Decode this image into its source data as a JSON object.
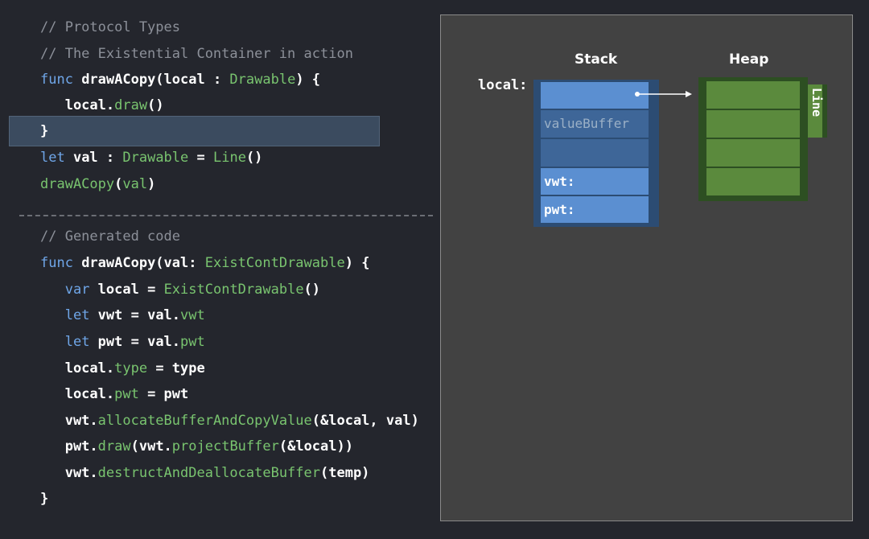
{
  "code": {
    "lines": [
      [
        {
          "t": "// Protocol Types",
          "c": "comment"
        }
      ],
      [
        {
          "t": "// The Existential Container in action",
          "c": "comment"
        }
      ],
      [
        {
          "t": "func",
          "c": "kw"
        },
        {
          "t": " drawACopy(local : ",
          "c": "w"
        },
        {
          "t": "Drawable",
          "c": "fn"
        },
        {
          "t": ") {",
          "c": "w"
        }
      ],
      [
        {
          "t": "   local.",
          "c": "w"
        },
        {
          "t": "draw",
          "c": "fn"
        },
        {
          "t": "()",
          "c": "w"
        }
      ],
      [
        {
          "t": "}",
          "c": "w"
        }
      ],
      [
        {
          "t": "let",
          "c": "kw"
        },
        {
          "t": " val : ",
          "c": "w"
        },
        {
          "t": "Drawable",
          "c": "fn"
        },
        {
          "t": " = ",
          "c": "w"
        },
        {
          "t": "Line",
          "c": "fn"
        },
        {
          "t": "()",
          "c": "w"
        }
      ],
      [
        {
          "t": "drawACopy",
          "c": "fn"
        },
        {
          "t": "(",
          "c": "w"
        },
        {
          "t": "val",
          "c": "fn"
        },
        {
          "t": ")",
          "c": "w"
        }
      ],
      [
        {
          "t": "// Generated code",
          "c": "comment"
        }
      ],
      [
        {
          "t": "func",
          "c": "kw"
        },
        {
          "t": " drawACopy(val: ",
          "c": "w"
        },
        {
          "t": "ExistContDrawable",
          "c": "fn"
        },
        {
          "t": ") {",
          "c": "w"
        }
      ],
      [
        {
          "t": "   ",
          "c": "w"
        },
        {
          "t": "var",
          "c": "kw"
        },
        {
          "t": " local = ",
          "c": "w"
        },
        {
          "t": "ExistContDrawable",
          "c": "fn"
        },
        {
          "t": "()",
          "c": "w"
        }
      ],
      [
        {
          "t": "   ",
          "c": "w"
        },
        {
          "t": "let",
          "c": "kw"
        },
        {
          "t": " vwt = val.",
          "c": "w"
        },
        {
          "t": "vwt",
          "c": "fn"
        }
      ],
      [
        {
          "t": "   ",
          "c": "w"
        },
        {
          "t": "let",
          "c": "kw"
        },
        {
          "t": " pwt = val.",
          "c": "w"
        },
        {
          "t": "pwt",
          "c": "fn"
        }
      ],
      [
        {
          "t": "   local.",
          "c": "w"
        },
        {
          "t": "type",
          "c": "fn"
        },
        {
          "t": " = type",
          "c": "w"
        }
      ],
      [
        {
          "t": "   local.",
          "c": "w"
        },
        {
          "t": "pwt",
          "c": "fn"
        },
        {
          "t": " = pwt",
          "c": "w"
        }
      ],
      [
        {
          "t": "   vwt.",
          "c": "w"
        },
        {
          "t": "allocateBufferAndCopyValue",
          "c": "fn"
        },
        {
          "t": "(&local, val)",
          "c": "w"
        }
      ],
      [
        {
          "t": "   pwt.",
          "c": "w"
        },
        {
          "t": "draw",
          "c": "fn"
        },
        {
          "t": "(vwt.",
          "c": "w"
        },
        {
          "t": "projectBuffer",
          "c": "fn"
        },
        {
          "t": "(&local))",
          "c": "w"
        }
      ],
      [
        {
          "t": "   vwt.",
          "c": "w"
        },
        {
          "t": "destructAndDeallocateBuffer",
          "c": "fn"
        },
        {
          "t": "(temp)",
          "c": "w"
        }
      ],
      [
        {
          "t": "}",
          "c": "w"
        }
      ]
    ]
  },
  "diagram": {
    "stack_label": "Stack",
    "heap_label": "Heap",
    "local_label": "local:",
    "cells": [
      "",
      "valueBuffer",
      "",
      "vwt:",
      "pwt:"
    ],
    "heap_cells": 4,
    "line_label": "Line"
  },
  "colors": {
    "background": "#24262d",
    "comment": "#8c9099",
    "keyword": "#6fa6e8",
    "function": "#79c46f",
    "stack_blue": "#5b8fd1",
    "heap_green": "#5b8a3d"
  }
}
